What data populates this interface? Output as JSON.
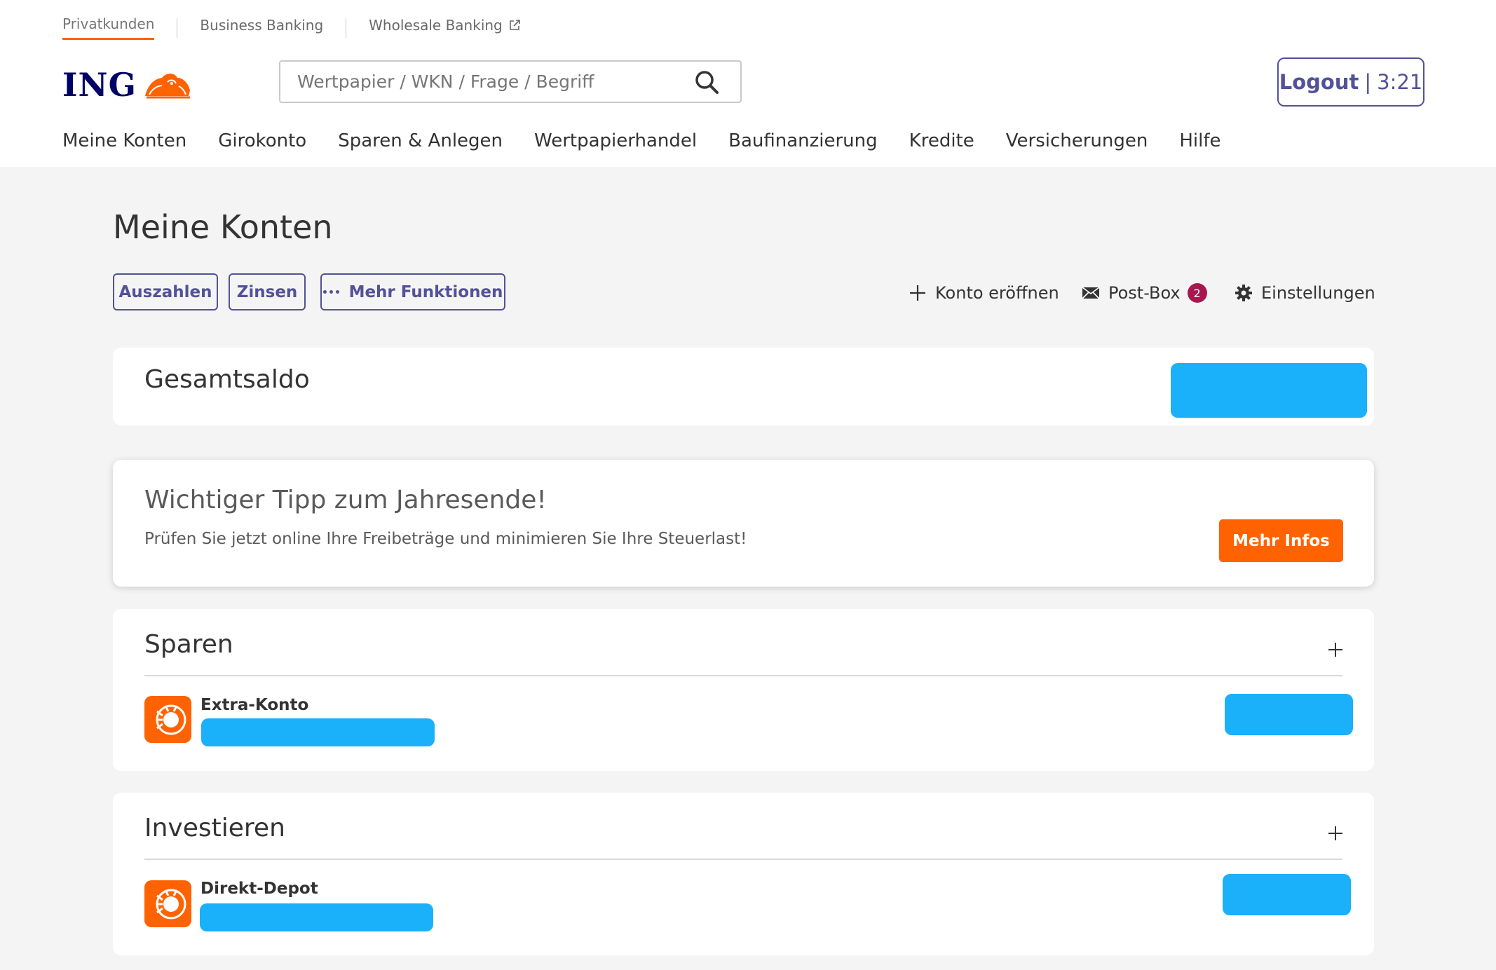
{
  "segments": [
    {
      "label": "Privatkunden",
      "active": true
    },
    {
      "label": "Business Banking",
      "active": false
    },
    {
      "label": "Wholesale Banking",
      "active": false,
      "icon": "external-link-icon"
    }
  ],
  "brand": {
    "name": "ING",
    "logo_icon": "lion-logo-icon",
    "primary_color": "#525199",
    "accent_color": "#ff6200",
    "redaction_color": "#1ab0fa"
  },
  "search": {
    "placeholder": "Wertpapier / WKN / Frage / Begriff",
    "value": "",
    "icon": "search-icon"
  },
  "logout": {
    "label": "Logout",
    "separator": "|",
    "timer": "3:21"
  },
  "main_nav": [
    "Meine Konten",
    "Girokonto",
    "Sparen & Anlegen",
    "Wertpapierhandel",
    "Baufinanzierung",
    "Kredite",
    "Versicherungen",
    "Hilfe"
  ],
  "page": {
    "title": "Meine Konten"
  },
  "actions": {
    "auszahlen": "Auszahlen",
    "zinsen": "Zinsen",
    "more": "Mehr Funktionen"
  },
  "tools": {
    "open_account": {
      "label": "Konto eröffnen",
      "icon": "plus-icon"
    },
    "postbox": {
      "label": "Post-Box",
      "icon": "envelope-icon",
      "badge": "2"
    },
    "settings": {
      "label": "Einstellungen",
      "icon": "gear-icon"
    }
  },
  "total": {
    "label": "Gesamtsaldo"
  },
  "tip": {
    "heading": "Wichtiger Tipp zum Jahresende!",
    "text": "Prüfen Sie jetzt online Ihre Freibeträge und minimieren Sie Ihre Steuerlast!",
    "button": "Mehr Infos"
  },
  "sections": [
    {
      "title": "Sparen",
      "expand_icon": "plus-icon",
      "accounts": [
        {
          "name": "Extra-Konto",
          "icon": "lion-logo-icon"
        }
      ]
    },
    {
      "title": "Investieren",
      "expand_icon": "plus-icon",
      "accounts": [
        {
          "name": "Direkt-Depot",
          "icon": "lion-logo-icon"
        }
      ]
    }
  ]
}
